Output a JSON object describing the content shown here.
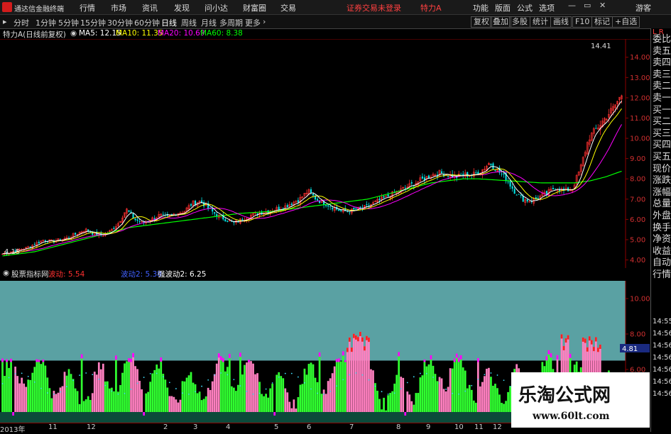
{
  "app": {
    "brand": "通达信金融终端",
    "menu": [
      "行情",
      "市场",
      "资讯",
      "发现",
      "问小达",
      "财富圈",
      "交易"
    ],
    "login_notice": "证券交易未登录",
    "stock_name": "特力A",
    "right_menu": [
      "功能",
      "版面",
      "公式",
      "选项"
    ],
    "user": "游客"
  },
  "periods": [
    "分时",
    "1分钟",
    "5分钟",
    "15分钟",
    "30分钟",
    "60分钟",
    "日线",
    "周线",
    "月线",
    "多周期",
    "更多"
  ],
  "active_period": "日线",
  "toolbar_right": [
    "复权",
    "叠加",
    "多股",
    "统计",
    "画线",
    "F10",
    "标记",
    "+自选"
  ],
  "info": {
    "title": "特力A(日线前复权)",
    "ma5": "MA5: 12.15",
    "ma10": "MA10: 11.35",
    "ma20": "MA20: 10.69",
    "ma60": "MA60: 8.38",
    "max_label": "14.41",
    "min_label": "4.15"
  },
  "sub": {
    "title": "股票指标网",
    "l1": "波动: 5.54",
    "l2": "波动2: 5.38",
    "l3": "强波动2: 6.25",
    "last_value": "4.81"
  },
  "colors": {
    "ma5": "#ffffff",
    "ma10": "#ffff00",
    "ma20": "#ff00ff",
    "ma60": "#00ff00",
    "up": "#ff3030",
    "down": "#00e5e5",
    "teal_band": "#5aa1a3",
    "dark_band": "#0c4a3a",
    "green_bar": "#30ff30",
    "pink_bar": "#ff80c0",
    "magenta": "#ff00ff",
    "red_top": "#ff2020"
  },
  "price_axis": [
    "14.00",
    "13.00",
    "12.00",
    "11.00",
    "10.00",
    "9.00",
    "8.00",
    "7.00",
    "6.00",
    "5.00",
    "4.00"
  ],
  "sub_axis": [
    "10.00",
    "8.00",
    "6.00",
    "4.00"
  ],
  "right_panel": {
    "items": [
      "委比",
      "卖五",
      "卖四",
      "卖三",
      "卖二",
      "卖一",
      "买一",
      "买二",
      "买三",
      "买四",
      "买五",
      "现价",
      "涨跌",
      "涨幅",
      "总量",
      "外盘",
      "换手",
      "净资",
      "收益",
      "自动",
      "行情"
    ],
    "times": [
      "14:55",
      "14:56",
      "14:56",
      "14:56",
      "14:56",
      "14:56",
      "14:56"
    ]
  },
  "time_axis": [
    "2013年",
    "11",
    "12",
    "2",
    "3",
    "4",
    "5",
    "6",
    "7",
    "8",
    "9",
    "10",
    "11",
    "12"
  ],
  "watermark": {
    "title": "乐淘公式网",
    "url": "www.60lt.com"
  },
  "chart_data": {
    "type": "candlestick",
    "title": "特力A(日线前复权)",
    "ylim": [
      3.6,
      14.9
    ],
    "ma5_last": 12.15,
    "ma10_last": 11.35,
    "ma20_last": 10.69,
    "ma60_last": 8.38,
    "close_trend": [
      4.3,
      4.4,
      4.5,
      4.6,
      4.8,
      5.0,
      4.9,
      5.0,
      5.1,
      5.3,
      5.5,
      5.3,
      5.2,
      5.4,
      5.8,
      6.5,
      6.0,
      5.8,
      6.0,
      6.2,
      6.1,
      6.3,
      6.4,
      6.8,
      6.9,
      6.5,
      6.2,
      6.0,
      5.8,
      6.0,
      6.2,
      6.3,
      6.4,
      6.5,
      6.6,
      6.8,
      7.0,
      7.4,
      7.0,
      6.8,
      6.6,
      6.4,
      6.4,
      6.5,
      6.6,
      6.8,
      7.0,
      7.2,
      7.4,
      7.6,
      7.8,
      8.0,
      8.2,
      8.3,
      8.2,
      8.1,
      8.2,
      8.2,
      8.4,
      8.8,
      8.4,
      8.0,
      7.4,
      7.0,
      6.9,
      7.1,
      7.3,
      7.6,
      7.4,
      7.5,
      8.5,
      10.0,
      10.5,
      11.0,
      11.5,
      12.15
    ],
    "ma60_trend": [
      4.2,
      4.3,
      4.4,
      4.6,
      4.8,
      5.0,
      5.2,
      5.4,
      5.6,
      5.7,
      5.8,
      5.9,
      6.0,
      6.1,
      6.2,
      6.3,
      6.35,
      6.4,
      6.5,
      6.6,
      6.7,
      6.8,
      6.9,
      7.0,
      7.2,
      7.4,
      7.6,
      7.8,
      7.9,
      8.0,
      8.0,
      7.95,
      7.9,
      7.85,
      7.8,
      7.8,
      7.8,
      7.9,
      8.1,
      8.38
    ],
    "osc": {
      "series": [
        {
          "name": "波动",
          "last": 5.54
        },
        {
          "name": "波动2",
          "last": 5.38
        },
        {
          "name": "强波动2",
          "last": 6.25
        }
      ],
      "ylim": [
        3.0,
        11.0
      ],
      "bands": {
        "upper": 6.5,
        "lower": 3.6
      }
    }
  }
}
